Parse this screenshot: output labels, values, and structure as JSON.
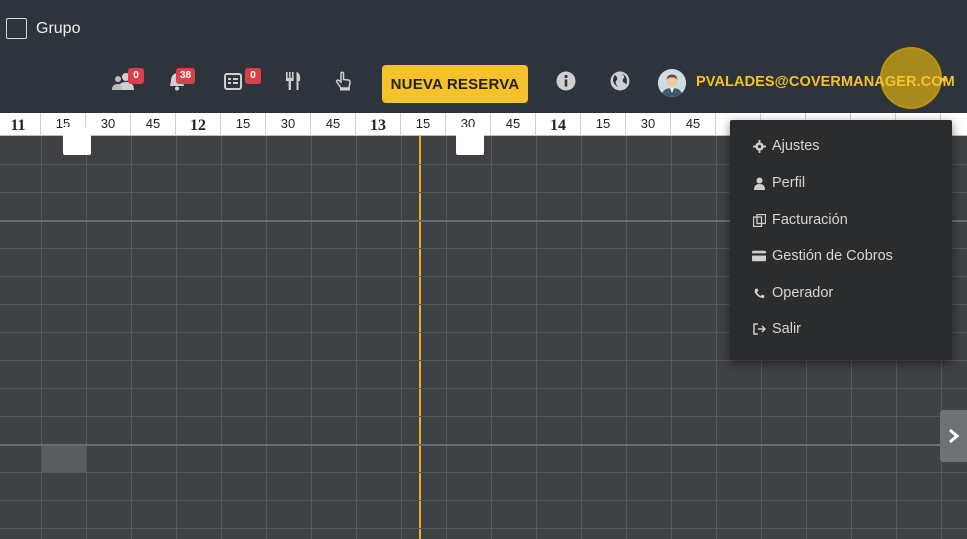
{
  "header": {
    "group_checkbox_label": "Grupo",
    "badges": {
      "people": "0",
      "alerts": "38",
      "list": "0"
    },
    "new_reservation_label": "NUEVA RESERVA",
    "user_email": "PVALADES@COVERMANAGER.COM"
  },
  "timeline": {
    "ticks": [
      "11",
      "15",
      "30",
      "45",
      "12",
      "15",
      "30",
      "45",
      "13",
      "15",
      "30",
      "45",
      "14",
      "15",
      "30",
      "45",
      "",
      "",
      "",
      "",
      ""
    ],
    "hour_ticks": [
      "11",
      "12",
      "13",
      "14"
    ]
  },
  "user_menu": {
    "items": [
      {
        "icon": "gear-icon",
        "label": "Ajustes"
      },
      {
        "icon": "user-icon",
        "label": "Perfil"
      },
      {
        "icon": "invoice-icon",
        "label": "Facturación"
      },
      {
        "icon": "credit-card-icon",
        "label": "Gestión de Cobros"
      },
      {
        "icon": "phone-icon",
        "label": "Operador"
      },
      {
        "icon": "logout-icon",
        "label": "Salir"
      }
    ]
  },
  "colors": {
    "accent": "#f6c22b",
    "header_bg": "#2e343b",
    "grid_bg": "#3f4144",
    "badge": "#d9414a"
  }
}
